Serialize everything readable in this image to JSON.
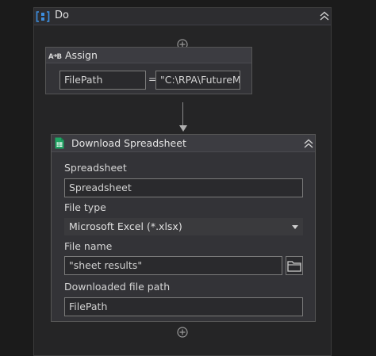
{
  "do_container": {
    "title": "Do"
  },
  "assign": {
    "title": "Assign",
    "to_value": "FilePath",
    "equals": "=",
    "value_expression": "\"C:\\RPA\\FutureM"
  },
  "download_spreadsheet": {
    "title": "Download Spreadsheet",
    "spreadsheet_label": "Spreadsheet",
    "spreadsheet_value": "Spreadsheet",
    "file_type_label": "File type",
    "file_type_selected": "Microsoft Excel (*.xlsx)",
    "file_name_label": "File name",
    "file_name_value": "\"sheet results\"",
    "downloaded_path_label": "Downloaded file path",
    "downloaded_path_value": "FilePath"
  },
  "icons": {
    "do": "sequence-icon",
    "assign": "assign-icon",
    "download": "google-sheets-icon",
    "collapse": "double-chevron-up-icon",
    "add": "plus-circle-icon",
    "browse": "folder-icon",
    "dropdown": "caret-down-icon"
  },
  "colors": {
    "background": "#1b1b1b",
    "panel": "#252526",
    "card": "#333337",
    "accent_blue": "#3d8fe0",
    "sheets_green": "#1fa463"
  }
}
